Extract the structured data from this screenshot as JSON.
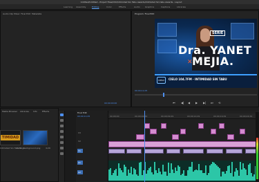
{
  "title_bar": {
    "text": "Untitled/Untitled - Project Files/CSV/Intimidad Sin Tabu Awards/Intimidad Sin tabu Awards - Layout"
  },
  "workspaces": {
    "items": [
      "Learning",
      "Assembly",
      "Editing",
      "Color",
      "Effects",
      "Audio",
      "Graphics",
      "Captions",
      "Libraries"
    ],
    "active": "Editing"
  },
  "source_panel": {
    "tabs": [
      "Audio Clip Mixer: Final Edit",
      "Metadata"
    ],
    "timecode": "00:00:00:00"
  },
  "program_monitor": {
    "tab": "Program: Final Edit",
    "overlay": {
      "serie": "SERIE",
      "name_line1": "Dra. YANET",
      "name_line2": "MEJIA.",
      "lower_third": "CIELO 104.7FM · INTIMIDAD SIN TABU",
      "logo": "CIELO"
    },
    "timecode": "00;00;11;05",
    "controls": [
      "⏮",
      "◀|",
      "◀",
      "▶",
      "▶|",
      "⏭",
      "⟲"
    ]
  },
  "project_panel": {
    "tabs": [
      "Media Browser",
      "Libraries",
      "Info",
      "Effects"
    ],
    "items": [
      {
        "name": "Intimidad Sin Tabu Logo",
        "duration": "4;29"
      },
      {
        "name": "background.png",
        "duration": "4;29"
      }
    ],
    "thumb_label": "TIMIDAD"
  },
  "timeline": {
    "tab": "Final Edit",
    "timecode": "00;00;11;05",
    "ruler_marks": [
      "00;00;00",
      "00;00;04;29",
      "00;00;09;29",
      "00;00;14;29",
      "00;00;19;29",
      "00;00;24;29"
    ],
    "tracks": [
      "V3",
      "V2",
      "V1",
      "A1",
      "A2"
    ]
  },
  "colors": {
    "accent": "#4d8ff0",
    "clip_pink": "#d48cd0",
    "clip_violet": "#b6a4d8",
    "audio_green": "#2cc6a7"
  }
}
